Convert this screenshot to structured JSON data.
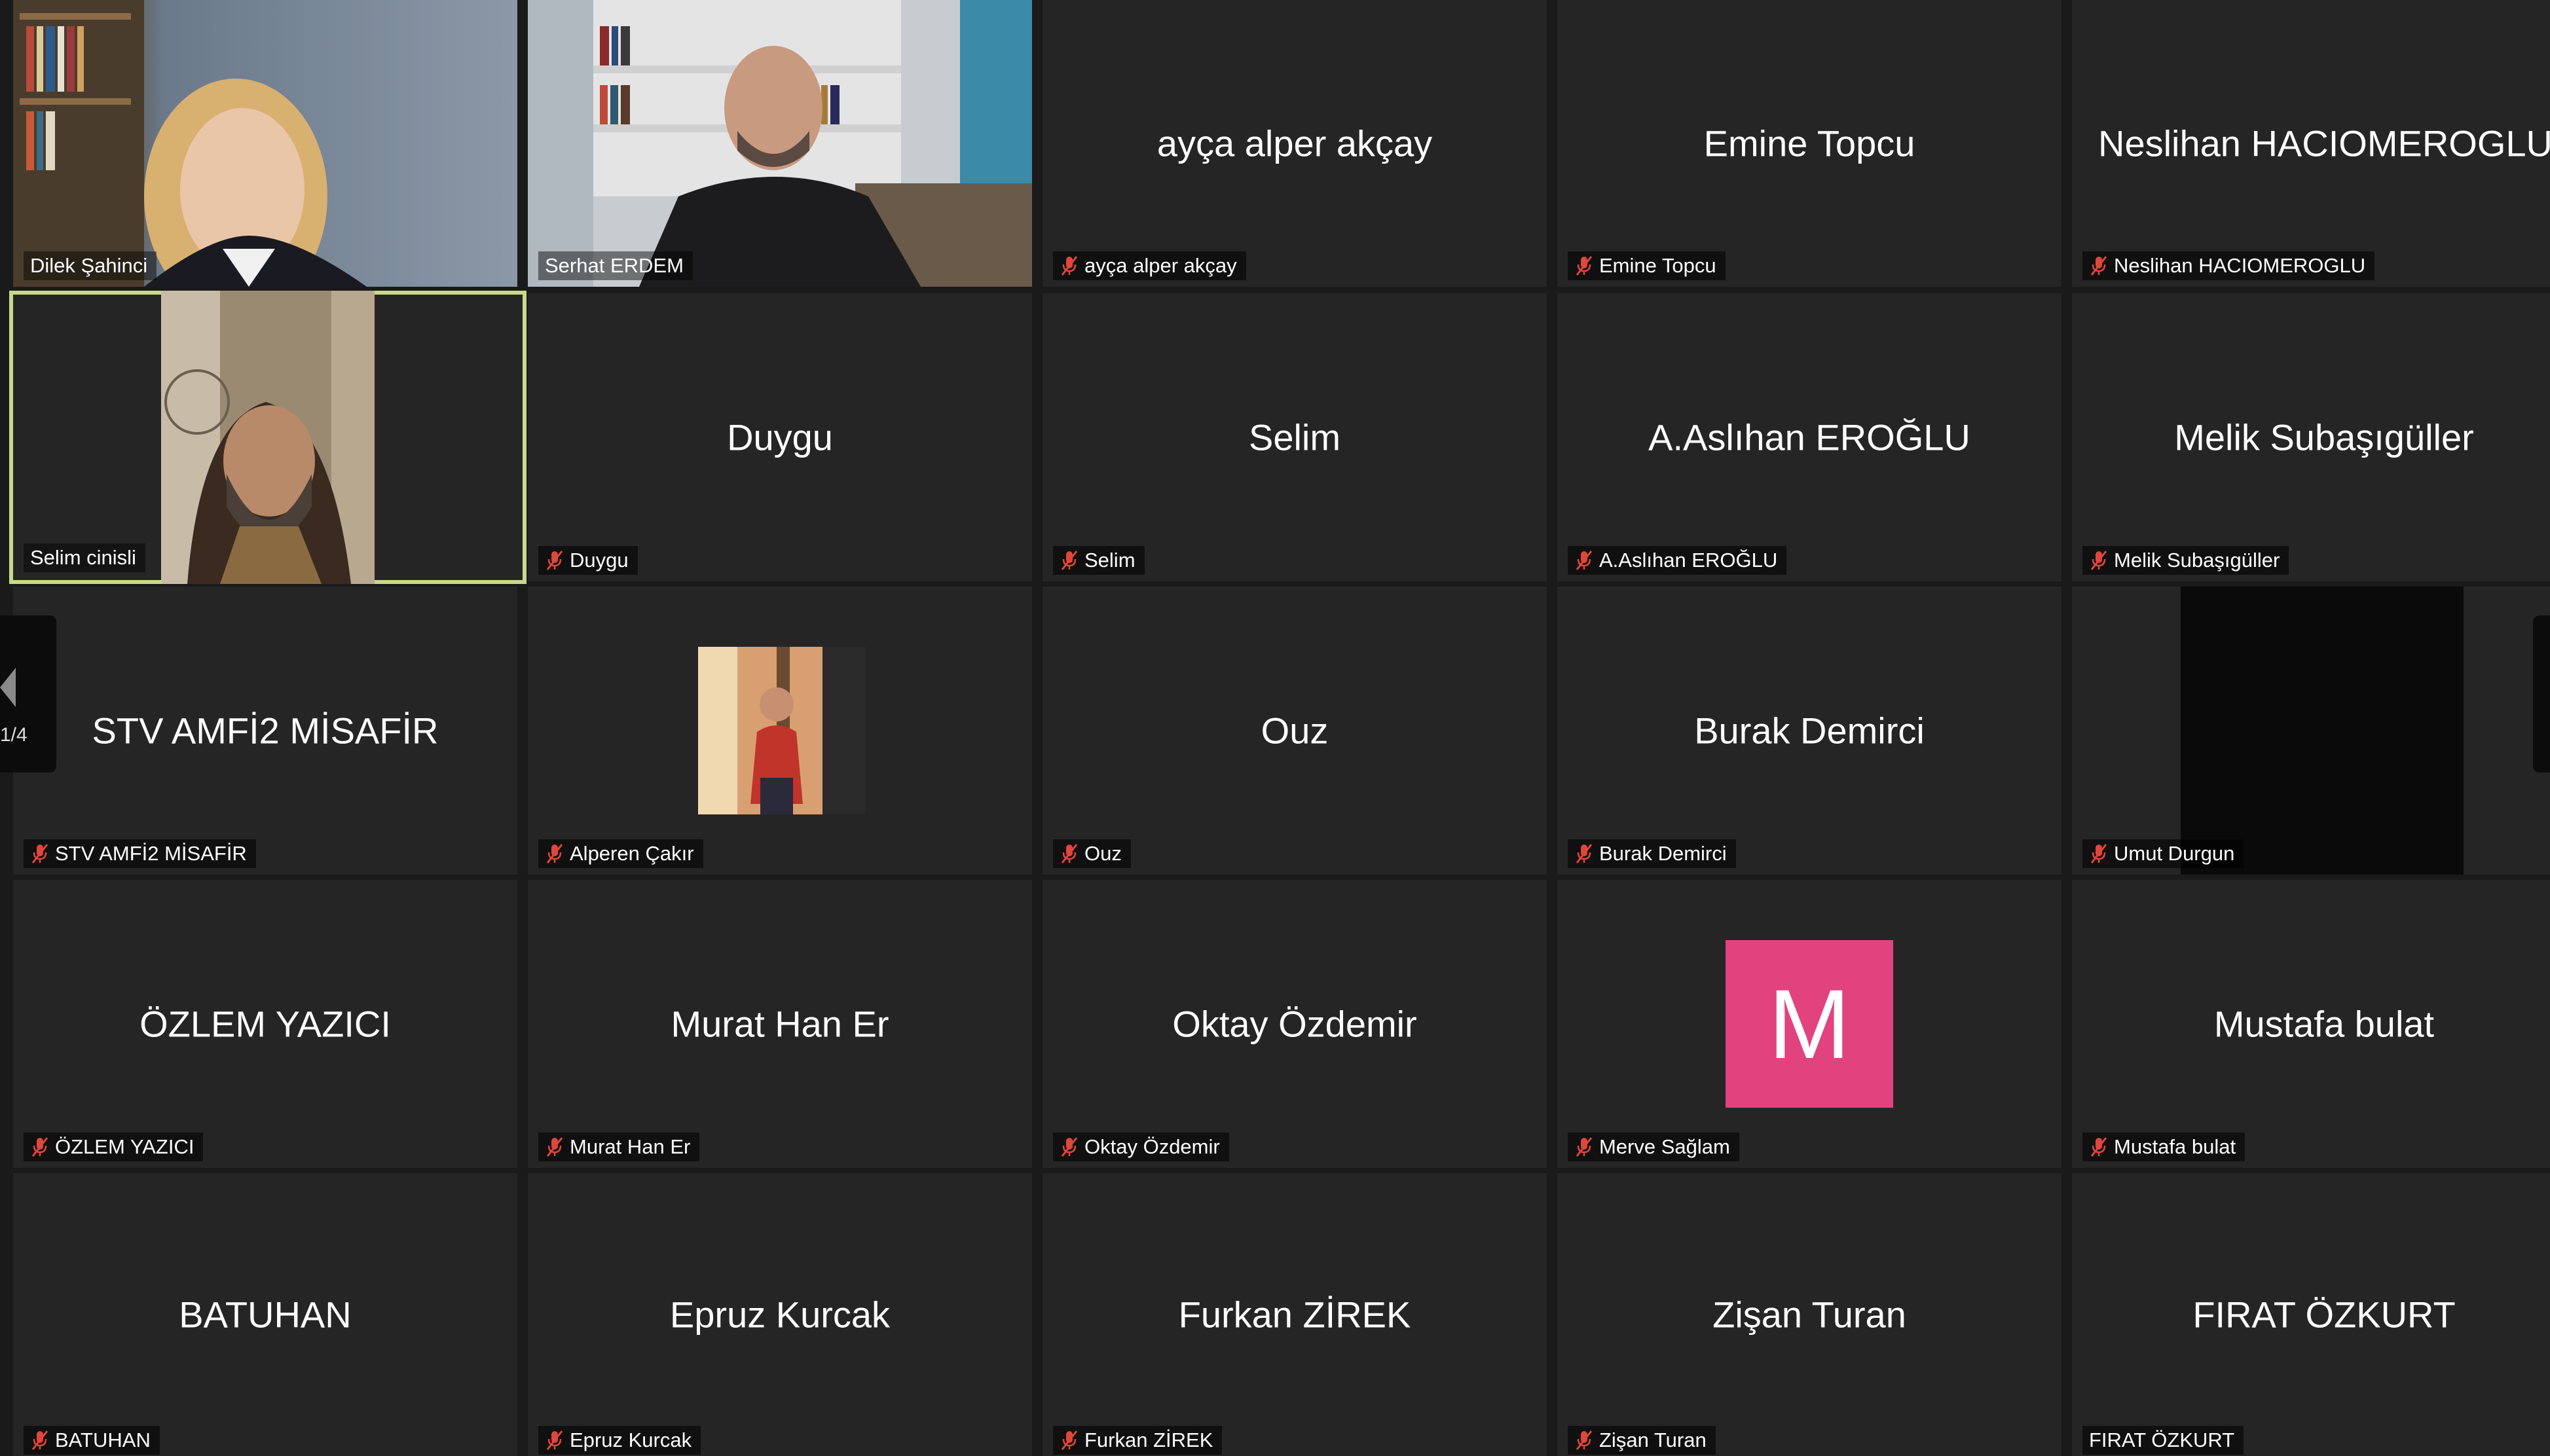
{
  "gallery": {
    "tiles": [
      {
        "name": "Dilek Şahinci",
        "label": "Dilek Şahinci"
      },
      {
        "name": "Serhat ERDEM",
        "label": "Serhat ERDEM"
      },
      {
        "name": "ayça alper akçay",
        "label": "ayça alper akçay"
      },
      {
        "name": "Emine Topcu",
        "label": "Emine Topcu"
      },
      {
        "name": "Neslihan HACIOMEROGLU",
        "label": "Neslihan HACIOMEROGLU"
      },
      {
        "name": "Selim cinisli",
        "label": "Selim cinisli"
      },
      {
        "name": "Duygu",
        "label": "Duygu"
      },
      {
        "name": "Selim",
        "label": "Selim"
      },
      {
        "name": "A.Aslıhan EROĞLU",
        "label": "A.Aslıhan EROĞLU"
      },
      {
        "name": "Melik Subaşıgüller",
        "label": "Melik Subaşıgüller"
      },
      {
        "name": "STV AMFİ2 MİSAFİR",
        "label": "STV AMFİ2 MİSAFİR"
      },
      {
        "name": "Alperen Çakır",
        "label": "Alperen Çakır"
      },
      {
        "name": "Ouz",
        "label": "Ouz"
      },
      {
        "name": "Burak Demirci",
        "label": "Burak Demirci"
      },
      {
        "name": "Umut Durgun",
        "label": "Umut Durgun"
      },
      {
        "name": "ÖZLEM YAZICI",
        "label": "ÖZLEM YAZICI"
      },
      {
        "name": "Murat Han Er",
        "label": "Murat Han Er"
      },
      {
        "name": "Oktay Özdemir",
        "label": "Oktay Özdemir"
      },
      {
        "name": "Merve Sağlam",
        "label": "Merve Sağlam",
        "avatar_letter": "M"
      },
      {
        "name": "Mustafa bulat",
        "label": "Mustafa bulat"
      },
      {
        "name": "BATUHAN",
        "label": "BATUHAN"
      },
      {
        "name": "Epruz Kurcak",
        "label": "Epruz Kurcak"
      },
      {
        "name": "Furkan ZİREK",
        "label": "Furkan ZİREK"
      },
      {
        "name": "Zişan Turan",
        "label": "Zişan Turan"
      },
      {
        "name": "FIRAT ÖZKURT",
        "label": "FIRAT ÖZKURT"
      }
    ]
  },
  "pager": {
    "count": "1/4"
  },
  "colors": {
    "muted_icon": "#e0463c",
    "active_speaker_border": "#c8d98a",
    "avatar_bg": "#e2437e"
  }
}
